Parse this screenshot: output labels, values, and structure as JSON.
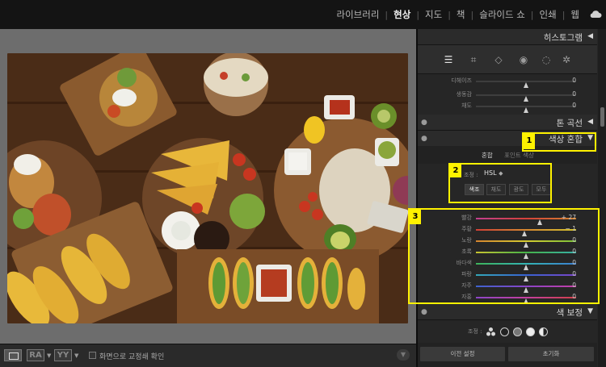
{
  "modules": [
    "라이브러리",
    "현상",
    "지도",
    "책",
    "슬라이드 쇼",
    "인쇄",
    "웹"
  ],
  "active_module": "현상",
  "toolbar": {
    "ra": "RA",
    "yy": "YY",
    "softproof_label": "화면으로 교정쇄 확인"
  },
  "panels": {
    "histogram": "히스토그램",
    "tone_curve": "톤 곡선",
    "color_mixer": "색상 혼합",
    "color_grading": "색 보정"
  },
  "basic_rows": [
    {
      "label": "디헤이즈",
      "value": "0",
      "pos": 0.5
    },
    {
      "label": "생동감",
      "value": "0",
      "pos": 0.5
    },
    {
      "label": "채도",
      "value": "0",
      "pos": 0.5
    }
  ],
  "mixer": {
    "tabs": [
      "혼합",
      "포인트 색상"
    ],
    "adjust_label": "조정 :",
    "mode": "HSL",
    "sub_tabs": [
      "색조",
      "채도",
      "광도",
      "모두"
    ],
    "rows": [
      {
        "label": "빨강",
        "value": "+ 27",
        "pos": 0.64
      },
      {
        "label": "주황",
        "value": "− 1",
        "pos": 0.49
      },
      {
        "label": "노랑",
        "value": "0",
        "pos": 0.5
      },
      {
        "label": "초록",
        "value": "0",
        "pos": 0.5
      },
      {
        "label": "바다색",
        "value": "0",
        "pos": 0.5
      },
      {
        "label": "파랑",
        "value": "0",
        "pos": 0.5
      },
      {
        "label": "자주",
        "value": "0",
        "pos": 0.5
      },
      {
        "label": "자홍",
        "value": "0",
        "pos": 0.5
      }
    ]
  },
  "color_grading_label": "조정 :",
  "footer": {
    "previous": "이전 설정",
    "reset": "초기화"
  },
  "callouts": [
    "1",
    "2",
    "3"
  ],
  "colors": {
    "callout": "#fff200"
  }
}
